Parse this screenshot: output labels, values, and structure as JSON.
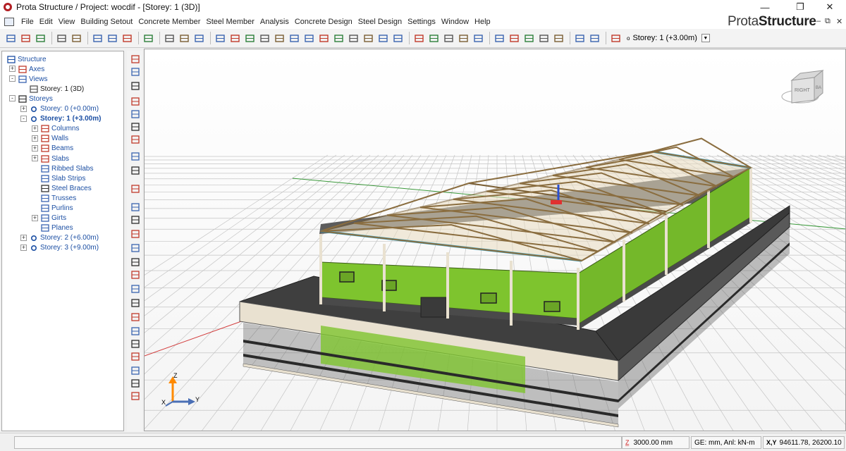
{
  "window": {
    "title": "Prota Structure / Project: wocdif - [Storey: 1 (3D)]",
    "minimize": "—",
    "maximize": "❐",
    "close": "✕"
  },
  "menubar": {
    "items": [
      "File",
      "Edit",
      "View",
      "Building Setout",
      "Concrete Member",
      "Steel Member",
      "Analysis",
      "Concrete Design",
      "Steel Design",
      "Settings",
      "Window",
      "Help"
    ],
    "brand_light": "Prota",
    "brand_bold": "Structure",
    "mdi_controls": [
      "–",
      "⧉",
      "✕"
    ]
  },
  "toolbar": {
    "storey_label": "Storey: 1 (+3.00m)",
    "icons": [
      "new-file-icon",
      "open-folder-icon",
      "save-icon",
      "print-icon",
      "print-preview-icon",
      "copy-icon",
      "undo-icon",
      "redo-icon",
      "zoom-extents-icon",
      "select-icon",
      "select-window-icon",
      "delete-icon",
      "pointer-icon",
      "line-icon",
      "axis-icon",
      "column-icon",
      "wall-icon",
      "beam-icon",
      "slab-icon",
      "steel-beam-icon",
      "truss-icon",
      "brace-icon",
      "stair-icon",
      "foundation-icon",
      "section-icon",
      "brace-x-icon",
      "purlin-icon",
      "roof-icon",
      "load-icon",
      "analysis-icon",
      "grid-view-icon",
      "frame-icon",
      "design-icon",
      "check-icon",
      "report-icon",
      "layers-icon",
      "list-icon",
      "settings-dd-icon"
    ]
  },
  "tree": {
    "items": [
      {
        "label": "Structure",
        "icon": "structure-icon",
        "style": "normal"
      },
      {
        "label": "Axes",
        "icon": "axes-icon",
        "style": "normal"
      },
      {
        "label": "Views",
        "icon": "views-icon",
        "style": "normal"
      },
      {
        "label": "Storey: 1 (3D)",
        "icon": "view-window-icon",
        "style": "dark"
      },
      {
        "label": "Storeys",
        "icon": "storeys-icon",
        "style": "normal"
      },
      {
        "label": "Storey: 0 (+0.00m)",
        "icon": "storey-icon",
        "style": "normal"
      },
      {
        "label": "Storey: 1 (+3.00m)",
        "icon": "storey-icon",
        "style": "bold"
      },
      {
        "label": "Columns",
        "icon": "column-icon",
        "style": "normal"
      },
      {
        "label": "Walls",
        "icon": "wall-icon",
        "style": "normal"
      },
      {
        "label": "Beams",
        "icon": "beam-icon",
        "style": "normal"
      },
      {
        "label": "Slabs",
        "icon": "slab-icon",
        "style": "normal"
      },
      {
        "label": "Ribbed Slabs",
        "icon": "ribbed-slab-icon",
        "style": "normal"
      },
      {
        "label": "Slab Strips",
        "icon": "slab-strip-icon",
        "style": "normal"
      },
      {
        "label": "Steel Braces",
        "icon": "steel-brace-icon",
        "style": "normal"
      },
      {
        "label": "Trusses",
        "icon": "truss-icon",
        "style": "normal"
      },
      {
        "label": "Purlins",
        "icon": "purlin-icon",
        "style": "normal"
      },
      {
        "label": "Girts",
        "icon": "girt-icon",
        "style": "normal"
      },
      {
        "label": "Planes",
        "icon": "plane-icon",
        "style": "normal"
      },
      {
        "label": "Storey: 2 (+6.00m)",
        "icon": "storey-icon",
        "style": "normal"
      },
      {
        "label": "Storey: 3 (+9.00m)",
        "icon": "storey-icon",
        "style": "normal"
      }
    ]
  },
  "viewport": {
    "viewcube_face": "RIGHT",
    "viewcube_side": "BA",
    "axis_labels": {
      "z": "Z",
      "x": "X",
      "y": "Y"
    }
  },
  "status": {
    "elevation": "3000.00 mm",
    "units": "GE: mm,  Anl: kN-m",
    "coords_label": "X,Y",
    "coords": "94611.78, 26200.10"
  },
  "colors": {
    "wall_green": "#7ec42e",
    "truss": "#8a6d3f",
    "slab": "#4f4f4f",
    "column": "#e9e1d0",
    "link": "#1c4fa3"
  }
}
